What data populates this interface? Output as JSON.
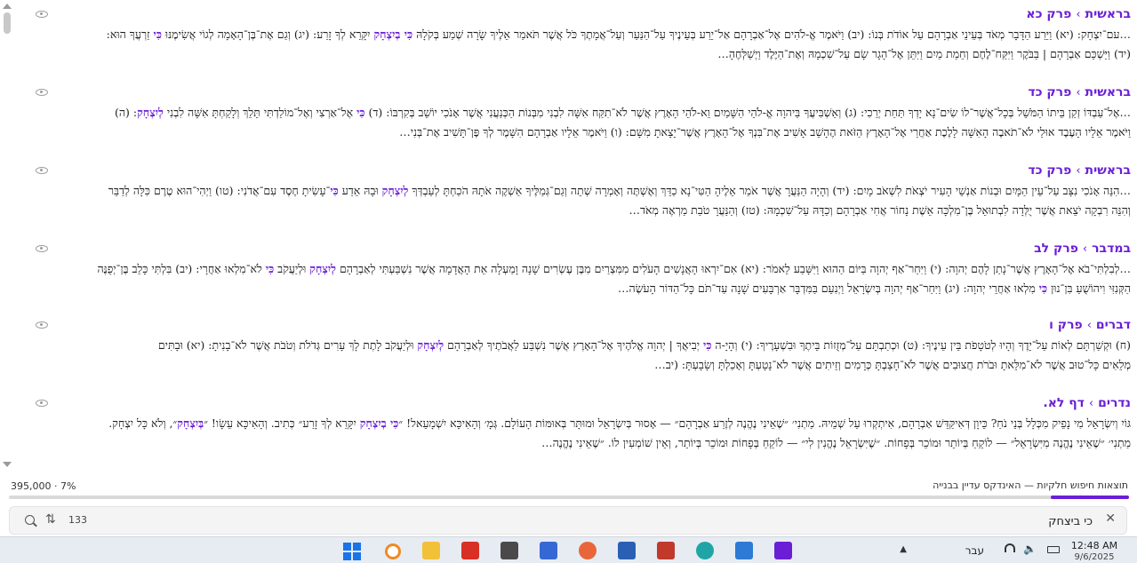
{
  "results": [
    {
      "book": "בראשית",
      "chapter": "פרק כא",
      "line1": [
        {
          "t": "…עם־יִצְחָק: (יא) וַיֵּרַע הַדָּבָר מְאֹד בְּעֵינֵי אַבְרָהָם עַל אוֹדֹת בְּנוֹ: (יב) וַיֹּאמֶר אֱ-לֹהִים אֶל־אַבְרָהָם אַל־יֵרַע בְּעֵינֶיךָ עַל־הַנַּעַר וְעַל־אֲמָתֶךָ כֹּל אֲשֶׁר תֹּאמַר אֵלֶיךָ שָׂרָה שְׁמַע בְּקֹלָהּ "
        },
        {
          "t": "כִּי בְיִצְחָק",
          "hl": true
        },
        {
          "t": " יִקָּרֵא לְךָ זָרַע: (יג) וְגַם אֶת־בֶּן־הָאָמָה לְגוֹי אֲשִׂימֶנּוּ "
        },
        {
          "t": "כִּי",
          "hl": true
        },
        {
          "t": " זַרְעֲךָ הוּא:"
        }
      ],
      "line2": [
        {
          "t": "(יד) וַיַּשְׁכֵּם אַבְרָהָם | בַּבֹּקֶר וַיִּקַּח־לֶחֶם וְחֵמַת מַיִם וַיִּתֵּן אֶל־הָגָר שָׂם עַל־שִׁכְמָהּ וְאֶת־הַיֶּלֶד וַיְשַׁלְּחֶהָ…"
        }
      ]
    },
    {
      "book": "בראשית",
      "chapter": "פרק כד",
      "line1": [
        {
          "t": "…אֶל־עַבְדּוֹ זְקַן בֵּיתוֹ הַמֹּשֵׁל בְּכָל־אֲשֶׁר־לוֹ שִׂים־נָא יָדְךָ תַּחַת יְרֵכִי: (ג) וְאַשְׁבִּיעֲךָ בַּיהוָה אֱ-לֹהֵי הַשָּׁמַיִם וֵא-לֹהֵי הָאָרֶץ אֲשֶׁר לֹא־תִקַּח אִשָּׁה לִבְנִי מִבְּנוֹת הַכְּנַעֲנִי אֲשֶׁר אָנֹכִי יוֹשֵׁב בְּקִרְבּוֹ: (ד) "
        },
        {
          "t": "כִּי",
          "hl": true
        },
        {
          "t": " אֶל־אַרְצִי וְאֶל־מוֹלַדְתִּי תֵּלֵךְ וְלָקַחְתָּ אִשָּׁה לִבְנִי "
        },
        {
          "t": "לְיִצְחָק",
          "hl": true
        },
        {
          "t": ": (ה)"
        }
      ],
      "line2": [
        {
          "t": "וַיֹּאמֶר אֵלָיו הָעֶבֶד אוּלַי לֹא־תֹאבֶה הָאִשָּׁה לָלֶכֶת אַחֲרַי אֶל־הָאָרֶץ הַזֹּאת הֶהָשֵׁב אָשִׁיב אֶת־בִּנְךָ אֶל־הָאָרֶץ אֲשֶׁר־יָצָאתָ מִשָּׁם: (ו) וַיֹּאמֶר אֵלָיו אַבְרָהָם הִשָּׁמֶר לְךָ פֶּן־תָּשִׁיב אֶת־בְּנִי…"
        }
      ]
    },
    {
      "book": "בראשית",
      "chapter": "פרק כד",
      "line1": [
        {
          "t": "…הִנֵּה אָנֹכִי נִצָּב עַל־עֵין הַמָּיִם וּבְנוֹת אַנְשֵׁי הָעִיר יֹצְאֹת לִשְׁאֹב מָיִם: (יד) וְהָיָה הַנַּעֲרָ אֲשֶׁר אֹמַר אֵלֶיהָ הַטִּי־נָא כַדֵּךְ וְאֶשְׁתֶּה וְאָמְרָה שְׁתֵה וְגַם־גְּמַלֶּיךָ אַשְׁקֶה אֹתָהּ הֹכַחְתָּ לְעַבְדְּךָ "
        },
        {
          "t": "לְיִצְחָק",
          "hl": true
        },
        {
          "t": " וּבָהּ אֵדַע "
        },
        {
          "t": "כִּי",
          "hl": true
        },
        {
          "t": "־עָשִׂיתָ חֶסֶד עִם־אֲדֹנִי: (טו) וַיְהִי־הוּא טֶרֶם כִּלָּה לְדַבֵּר"
        }
      ],
      "line2": [
        {
          "t": "וְהִנֵּה רִבְקָה יֹצֵאת אֲשֶׁר יֻלְּדָה לִבְתוּאֵל בֶּן־מִלְכָּה אֵשֶׁת נָחוֹר אֲחִי אַבְרָהָם וְכַדָּהּ עַל־שִׁכְמָהּ: (טז) וְהַנַּעֲרָ טֹבַת מַרְאֶה מְאֹד…"
        }
      ]
    },
    {
      "book": "במדבר",
      "chapter": "פרק לב",
      "line1": [
        {
          "t": "…לְבִלְתִּי־בֹא אֶל־הָאָרֶץ אֲשֶׁר־נָתַן לָהֶם יְהוָה: (י) וַיִּחַר־אַף יְהוָה בַּיּוֹם הַהוּא וַיִּשָּׁבַע לֵאמֹר: (יא) אִם־יִרְאוּ הָאֲנָשִׁים הָעֹלִים מִמִּצְרַיִם מִבֶּן עֶשְׂרִים שָׁנָה וָמַעְלָה אֵת הָאֲדָמָה אֲשֶׁר נִשְׁבַּעְתִּי לְאַבְרָהָם "
        },
        {
          "t": "לְיִצְחָק",
          "hl": true
        },
        {
          "t": " וּלְיַעֲקֹב "
        },
        {
          "t": "כִּי",
          "hl": true
        },
        {
          "t": " לֹא־מִלְאוּ אַחֲרָי: (יב) בִּלְתִּי כָּלֵב בֶּן־יְפֻנֶּה"
        }
      ],
      "line2": [
        {
          "t": "הַקְּנִזִּי וִיהוֹשֻׁעַ בִּן־נוּן "
        },
        {
          "t": "כִּי",
          "hl": true
        },
        {
          "t": " מִלְאוּ אַחֲרֵי יְהוָה: (יג) וַיִּחַר־אַף יְהוָה בְּיִשְׂרָאֵל וַיְנִעֵם בַּמִּדְבָּר אַרְבָּעִים שָׁנָה עַד־תֹּם כָּל־הַדּוֹר הָעֹשֶׂה…"
        }
      ]
    },
    {
      "book": "דברים",
      "chapter": "פרק ו",
      "line1": [
        {
          "t": "(ח) וּקְשַׁרְתָּם לְאוֹת עַל־יָדֶךָ וְהָיוּ לְטֹטָפֹת בֵּין עֵינֶיךָ: (ט) וּכְתַבְתָּם עַל־מְזֻזוֹת בֵּיתֶךָ וּבִשְׁעָרֶיךָ:               (י) וְהָיָ-ה "
        },
        {
          "t": "כִּי",
          "hl": true
        },
        {
          "t": " יְבִיאֲךָ | יְהוָה אֱלֹהֶיךָ אֶל־הָאָרֶץ אֲשֶׁר נִשְׁבַּע לַאֲבֹתֶיךָ לְאַבְרָהָם "
        },
        {
          "t": "לְיִצְחָק",
          "hl": true
        },
        {
          "t": " וּלְיַעֲקֹב לָתֶת לָךְ עָרִים גְּדֹלֹת וְטֹבֹת אֲשֶׁר לֹא־בָנִיתָ: (יא) וּבָתִּים"
        }
      ],
      "line2": [
        {
          "t": "מְלֵאִים כָּל־טוּב אֲשֶׁר לֹא־מִלֵּאתָ וּבֹרֹת חֲצוּבִים אֲשֶׁר לֹא־חָצַבְתָּ כְּרָמִים וְזֵיתִים אֲשֶׁר לֹא־נָטָעְתָּ וְאָכַלְתָּ וְשָׂבָעְתָּ: (יב…"
        }
      ]
    },
    {
      "book": "נדרים",
      "chapter": "דף לא.",
      "line1": [
        {
          "t": "גּוֹיִ וְיִשְׂרָאֵל מִי נָפֵיק מִכְּלָל בְּנֵי נֹחַ? כֵּיוָן דְּאִיקַּדֵּשׁ אַבְרָהָם, אִיתְקְרוּ עַל שְׁמֵיהּ. מַתְנִי׳ ״שֶׁאֵינִי נֶהֱנֶה לְזֶרַע אַבְרָהָם״ — אָסוּר בְּיִשְׂרָאֵל וּמוּתָּר בְּאוּמּוֹת הָעוֹלָם. גְּמָ׳ וְהָאִיכָּא יִשְׁמָעֵאל! ״"
        },
        {
          "t": "כִּי בְיִצְחָק",
          "hl": true
        },
        {
          "t": " יִקָּרֵא לְךָ זָרַע״ כְּתִיב. וְהָאִיכָּא עֵשָׂו! ״"
        },
        {
          "t": "בְּיִצְחָק",
          "hl": true
        },
        {
          "t": "״, וְלֹא כָּל יִצְחָק."
        }
      ],
      "line2": [
        {
          "t": "מַתְנִי׳ ״שֶׁאֵינִי נֶהֱנֶה מִיִּשְׂרָאֵל״ — לוֹקֵחַ בְּיוֹתֵר וּמוֹכֵר בְּפָחוֹת. ״שֶׁיִּשְׂרָאֵל נֶהֱנִין לִי״ — לוֹקֵחַ בְּפָחוֹת וּמוֹכֵר בְּיוֹתֵר, וְאֵין שׁוֹמְעִין לוֹ. ״שֶׁאֵינִי נֶהֱנֶה…"
        }
      ]
    }
  ],
  "status": {
    "count": "395,000 · 7%",
    "message": "תוצאות חיפוש חלקיות — האינדקס עדיין בבנייה",
    "progress_fraction": 0.07
  },
  "search": {
    "query": "כי ביצחק",
    "result_count": "133"
  },
  "taskbar": {
    "lang": "עבר",
    "time": "12:48 AM",
    "date": "9/6/2025"
  },
  "colors": {
    "accent": "#6a1fd6"
  },
  "icons": {
    "eye": "eye-icon",
    "search": "search-icon",
    "sort": "sort-icon",
    "clear": "clear-icon"
  }
}
